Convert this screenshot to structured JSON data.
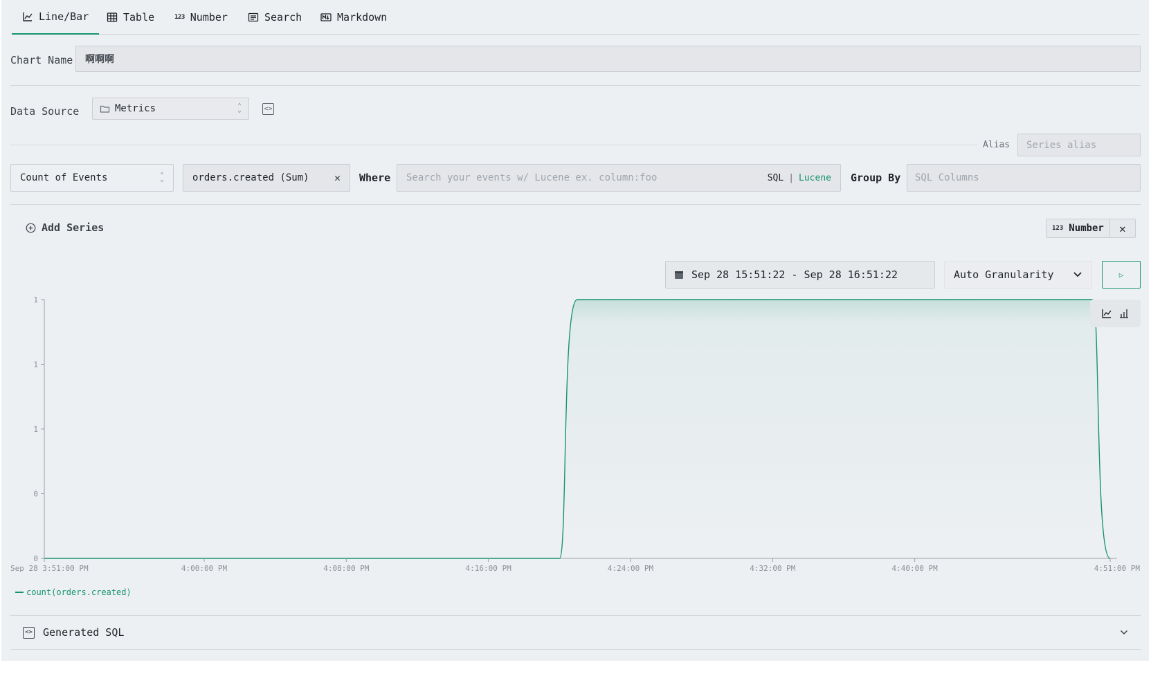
{
  "tabs": [
    {
      "label": "Line/Bar",
      "icon": "line-chart-icon",
      "active": true
    },
    {
      "label": "Table",
      "icon": "table-icon"
    },
    {
      "label": "Number",
      "icon": "number-icon"
    },
    {
      "label": "Search",
      "icon": "search-list-icon"
    },
    {
      "label": "Markdown",
      "icon": "markdown-icon"
    }
  ],
  "chart_name": {
    "label": "Chart Name",
    "value": "啊啊啊"
  },
  "data_source": {
    "label": "Data Source",
    "value": "Metrics"
  },
  "alias": {
    "label": "Alias",
    "placeholder": "Series alias"
  },
  "series": {
    "aggregation": "Count of Events",
    "metric": "orders.created (Sum)",
    "where_label": "Where",
    "where_placeholder": "Search your events w/ Lucene ex. column:foo",
    "sql_label": "SQL",
    "separator": "|",
    "lucene_label": "Lucene",
    "group_by_label": "Group By",
    "group_by_placeholder": "SQL Columns"
  },
  "add_series_label": "Add Series",
  "number_badge": {
    "icon_text": "123",
    "label": "Number"
  },
  "time_range": "Sep 28 15:51:22 - Sep 28 16:51:22",
  "granularity": "Auto Granularity",
  "generated_sql_label": "Generated SQL",
  "colors": {
    "accent": "#16946b",
    "panel": "#edf0f3"
  },
  "chart_data": {
    "type": "line",
    "x": [
      "3:51 PM",
      "4:20 PM",
      "4:21 PM",
      "4:50 PM",
      "4:51 PM"
    ],
    "series": [
      {
        "name": "count(orders.created)",
        "values": [
          0,
          0,
          1,
          1,
          0
        ]
      }
    ],
    "x_tick_labels": [
      "Sep 28 3:51:00 PM",
      "4:00:00 PM",
      "4:08:00 PM",
      "4:16:00 PM",
      "4:24:00 PM",
      "4:32:00 PM",
      "4:40:00 PM",
      "4:51:00 PM"
    ],
    "y_tick_labels": [
      "1",
      "1",
      "1",
      "0",
      "0"
    ],
    "ylim": [
      0,
      1
    ],
    "legend_position": "bottom-left",
    "grid": false
  }
}
